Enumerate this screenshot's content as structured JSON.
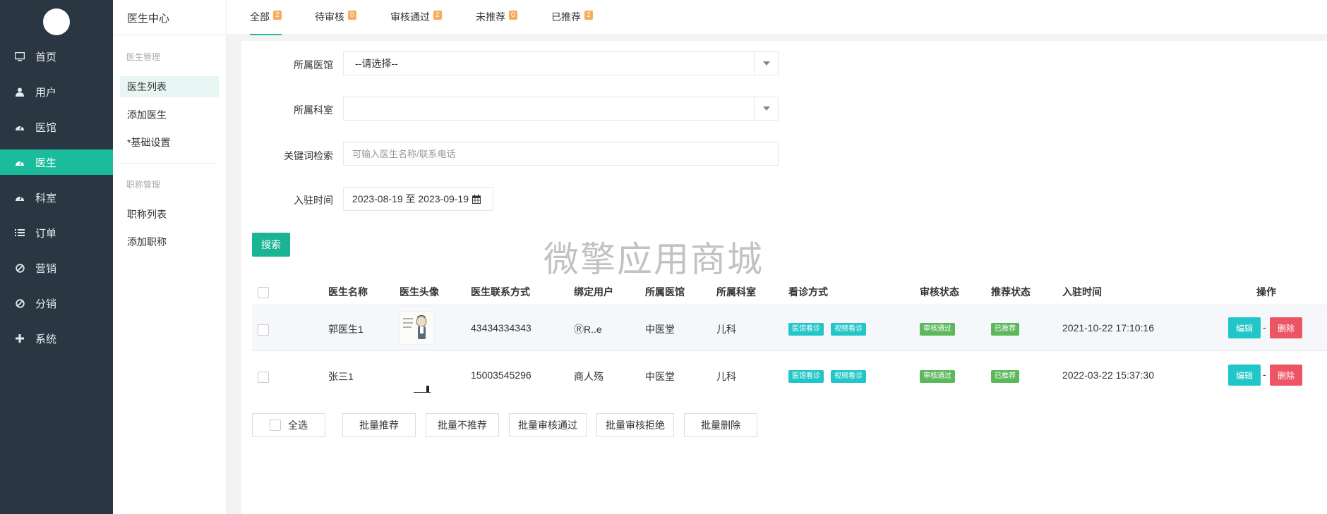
{
  "sidebar": {
    "items": [
      {
        "label": "首页",
        "icon": "monitor-icon"
      },
      {
        "label": "用户",
        "icon": "user-icon"
      },
      {
        "label": "医馆",
        "icon": "dashboard-icon"
      },
      {
        "label": "医生",
        "icon": "dashboard-icon",
        "active": true
      },
      {
        "label": "科室",
        "icon": "dashboard-icon"
      },
      {
        "label": "订单",
        "icon": "list-icon"
      },
      {
        "label": "营销",
        "icon": "ban-icon"
      },
      {
        "label": "分销",
        "icon": "ban-icon"
      },
      {
        "label": "系统",
        "icon": "plus-icon"
      }
    ],
    "active_color": "#1abc9c",
    "bg_color": "#2b3643"
  },
  "subnav": {
    "title": "医生中心",
    "group1": "医生管理",
    "links1": [
      "医生列表",
      "添加医生",
      "*基础设置"
    ],
    "group2": "职称管理",
    "links2": [
      "职称列表",
      "添加职称"
    ]
  },
  "tabs": [
    {
      "label": "全部",
      "count": "2"
    },
    {
      "label": "待审核",
      "count": "0"
    },
    {
      "label": "审核通过",
      "count": "2"
    },
    {
      "label": "未推荐",
      "count": "0"
    },
    {
      "label": "已推荐",
      "count": "2"
    }
  ],
  "filters": {
    "hospital_label": "所属医馆",
    "hospital_value": "--请选择--",
    "department_label": "所属科室",
    "department_value": "",
    "keyword_label": "关键词检索",
    "keyword_placeholder": "可输入医生名称/联系电话",
    "date_label": "入驻时间",
    "date_value": "2023-08-19 至 2023-09-19",
    "search_button": "搜索"
  },
  "watermark": "微擎应用商城",
  "table": {
    "headers": [
      "医生名称",
      "医生头像",
      "医生联系方式",
      "绑定用户",
      "所属医馆",
      "所属科室",
      "看诊方式",
      "审核状态",
      "推荐状态",
      "入驻时间",
      "操作"
    ],
    "rows": [
      {
        "name": "郭医生1",
        "phone": "43434334343",
        "user": "ⓇR..e",
        "hospital": "中医堂",
        "department": "儿科",
        "mode1": "医馆看诊",
        "mode2": "视频看诊",
        "audit": "审核通过",
        "recommend": "已推荐",
        "time": "2021-10-22 17:10:16"
      },
      {
        "name": "张三1",
        "phone": "15003545296",
        "user": "商人殇",
        "hospital": "中医堂",
        "department": "儿科",
        "mode1": "医馆看诊",
        "mode2": "视频看诊",
        "audit": "审核通过",
        "recommend": "已推荐",
        "time": "2022-03-22 15:37:30"
      }
    ],
    "edit_label": "编辑",
    "delete_label": "删除",
    "separator": "-"
  },
  "bulk": {
    "select_all": "全选",
    "actions": [
      "批量推荐",
      "批量不推荐",
      "批量审核通过",
      "批量审核拒绝",
      "批量删除"
    ]
  }
}
